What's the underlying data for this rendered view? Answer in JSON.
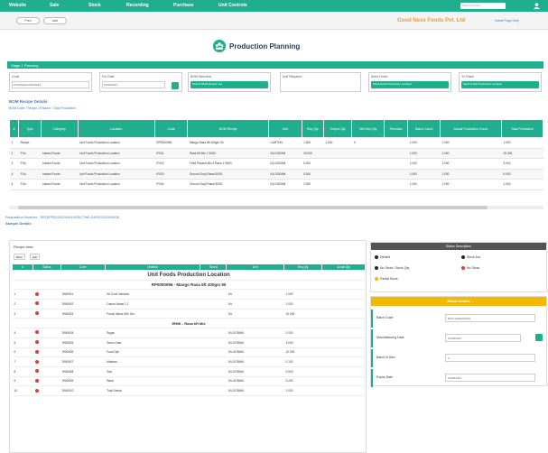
{
  "nav": {
    "items": [
      "Website",
      "Sale",
      "Stock",
      "Recording",
      "Purchase",
      "Unit Controls"
    ],
    "search_placeholder": "Search Options"
  },
  "subbar": {
    "pills": [
      "Prev",
      "add"
    ],
    "company": "Good Ness Foods Pvt. Ltd",
    "links": "Home Page Help"
  },
  "page": {
    "title": "Production Planning",
    "section": "Stage 1 Planning"
  },
  "fields": [
    {
      "label": "Code",
      "value": "PLANNING/2023/0015"
    },
    {
      "label": "For Date",
      "value": "10/08/2023"
    },
    {
      "label": "BOM Selection",
      "button": "Search BOM Recipe List"
    },
    {
      "label": "Unit Required",
      "value": ""
    },
    {
      "label": "Send Finish",
      "button": "Send Finish Production Location"
    },
    {
      "label": "To Finish",
      "button": "Send Finish Production Location"
    }
  ],
  "bom": {
    "title": "BOM Recipe Details",
    "breadcrumb": "BOM Code / Recipe Of Name / Total Production",
    "headers": [
      "#",
      "Type",
      "Category",
      "Location",
      "Code",
      "BOM Recipe",
      "Unit",
      "Req Qty",
      "Output Qty",
      "Net Req Qty",
      "Remarks",
      "Batch Count",
      "Actual Production Count",
      "Total Production"
    ],
    "rows": [
      [
        "1",
        "Recipe",
        "",
        "Unit Foods Production Location",
        "RP0000096",
        "Mango Rasa 6ft 400gm 90",
        "CARTON",
        "1.000",
        "1.000",
        "0",
        "",
        "1.000",
        "1.000",
        "1.000"
      ],
      [
        "2",
        "FGs",
        "Instant Foods",
        "Unit Foods Production Location",
        "IF001",
        "Rasa 6ft Mix 1 500G",
        "KILOGRAM",
        "20.000",
        "",
        "",
        "",
        "1.000",
        "1.000",
        "20.000"
      ],
      [
        "3",
        "FGs",
        "Instant Foods",
        "Unit Foods Production Location",
        "IF002",
        "Fried Packed Mix 6 Rasa 1 500G",
        "KILOGRAM",
        "5.000",
        "",
        "",
        "",
        "1.000",
        "1.000",
        "5.000"
      ],
      [
        "4",
        "FGs",
        "Instant Foods",
        "Unit Foods Production Location",
        "IF003",
        "Ground Sooji Rawa 500G",
        "KILOGRAM",
        "5.000",
        "",
        "",
        "",
        "1.000",
        "1.000",
        "5.000"
      ],
      [
        "5",
        "FGs",
        "Instant Foods",
        "Unit Foods Production Location",
        "IF004",
        "Ground Sooji Rawa 500G",
        "KILOGRAM",
        "2.000",
        "",
        "",
        "",
        "1.000",
        "1.000",
        "2.000"
      ]
    ]
  },
  "req": {
    "number": "Requisition Number : REQ/PRD/2023/0015/ON-THE-DATE/2023/04/08",
    "sample": "Sample Details"
  },
  "recipe": {
    "label": "Recipe view",
    "buttons": [
      "Back",
      "Edit"
    ],
    "headers": [
      "#",
      "Status",
      "Code",
      "Material",
      "Brand",
      "Unit",
      "Req Qty",
      "Actual Qty"
    ],
    "location_title": "Unit Foods Production Location",
    "recipe_line": "RP0000096 - Mango Rasa 6ft 400gm 90",
    "rows_a": [
      [
        "1",
        "RM0001",
        "Kit Cook Harrison",
        "Kit",
        "1.000"
      ],
      [
        "2",
        "RM0002",
        "Carton Name 1 2",
        "Kit",
        "1.000"
      ],
      [
        "3",
        "RM0003",
        "Pouch Name 400 Gm",
        "Kit",
        "10.000"
      ]
    ],
    "group_title": "IRMK - Rasa 6ft Mix",
    "rows_b": [
      [
        "4",
        "RM0004",
        "Sugar",
        "KILOGRAM",
        "2.000"
      ],
      [
        "5",
        "RM0005",
        "Semo Oats",
        "KILOGRAM",
        "3.000"
      ],
      [
        "6",
        "RM0006",
        "Food Dye",
        "KILOGRAM",
        "10.000"
      ],
      [
        "7",
        "RM0007",
        "Mustard",
        "KILOGRAM",
        "0.100"
      ],
      [
        "8",
        "RM0008",
        "Salt",
        "KILOGRAM",
        "0.500"
      ],
      [
        "9",
        "RM0009",
        "Rasa",
        "KILOGRAM",
        "0.200"
      ],
      [
        "10",
        "RM0010",
        "Tulsi Stevia",
        "KILOGRAM",
        "1.000"
      ]
    ]
  },
  "legend": {
    "header": "Status Description",
    "items": [
      {
        "label": "Default",
        "color": "#222222"
      },
      {
        "label": "Stock low",
        "color": "#222222"
      },
      {
        "label": "No Stock / Stock Qty",
        "color": "#222222"
      },
      {
        "label": "No Stock",
        "color": "#e53935"
      },
      {
        "label": "Partial Stock",
        "color": "#f5b800"
      }
    ]
  },
  "batch": {
    "header": "Batch Details",
    "rows": [
      {
        "label": "Batch Code",
        "value": "BATCH/2023/0015"
      },
      {
        "label": "Manufacturing Date",
        "value": "10/08/2023"
      },
      {
        "label": "Batch In Size",
        "value": "0"
      },
      {
        "label": "Expiry Date",
        "value": "10/08/2024"
      }
    ]
  },
  "colors": {
    "accent": "#1fae8e",
    "orange": "#f39a2e",
    "yellow": "#f5b800",
    "link": "#3b7bbf"
  }
}
